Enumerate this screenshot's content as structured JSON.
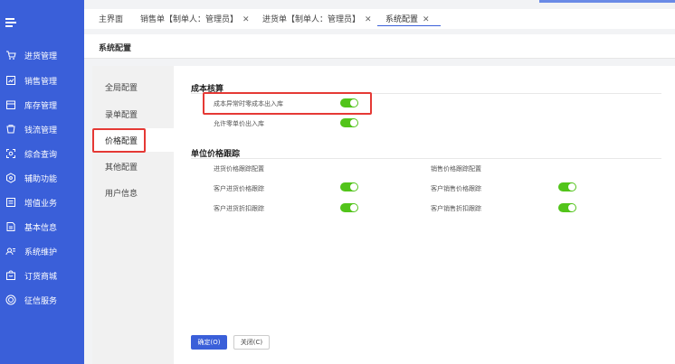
{
  "colors": {
    "sidebar": "#3a5fd9",
    "toggle_on": "#52c41a",
    "highlight": "#e53935"
  },
  "sidebar": {
    "items": [
      {
        "label": "进货管理",
        "icon": "cart-icon"
      },
      {
        "label": "销售管理",
        "icon": "sales-icon"
      },
      {
        "label": "库存管理",
        "icon": "inventory-icon"
      },
      {
        "label": "钱流管理",
        "icon": "money-icon"
      },
      {
        "label": "综合查询",
        "icon": "query-icon"
      },
      {
        "label": "辅助功能",
        "icon": "assist-icon"
      },
      {
        "label": "增值业务",
        "icon": "value-added-icon"
      },
      {
        "label": "基本信息",
        "icon": "info-icon"
      },
      {
        "label": "系统维护",
        "icon": "maintenance-icon"
      },
      {
        "label": "订货商城",
        "icon": "mall-icon"
      },
      {
        "label": "征信服务",
        "icon": "credit-icon"
      }
    ]
  },
  "tabs": [
    {
      "label": "主界面",
      "closable": false
    },
    {
      "label": "销售单【制单人：管理员】",
      "closable": true
    },
    {
      "label": "进货单【制单人：管理员】",
      "closable": true
    },
    {
      "label": "系统配置",
      "closable": true,
      "active": true
    }
  ],
  "page": {
    "title": "系统配置"
  },
  "menu": [
    {
      "label": "全局配置"
    },
    {
      "label": "录单配置"
    },
    {
      "label": "价格配置",
      "active": true
    },
    {
      "label": "其他配置"
    },
    {
      "label": "用户信息"
    }
  ],
  "cost": {
    "title": "成本核算",
    "items": [
      {
        "label": "成本异常时零成本出入库",
        "enabled": true
      },
      {
        "label": "允许零单价出入库",
        "enabled": true
      }
    ]
  },
  "tracking": {
    "title": "单位价格跟踪",
    "purchase": {
      "header": "进货价格跟踪配置",
      "items": [
        {
          "label": "客户进货价格跟踪",
          "enabled": true
        },
        {
          "label": "客户进货折扣跟踪",
          "enabled": true
        }
      ]
    },
    "sales": {
      "header": "销售价格跟踪配置",
      "items": [
        {
          "label": "客户销售价格跟踪",
          "enabled": true
        },
        {
          "label": "客户销售折扣跟踪",
          "enabled": true
        }
      ]
    }
  },
  "buttons": {
    "ok": "确定(O)",
    "close": "关闭(C)"
  }
}
